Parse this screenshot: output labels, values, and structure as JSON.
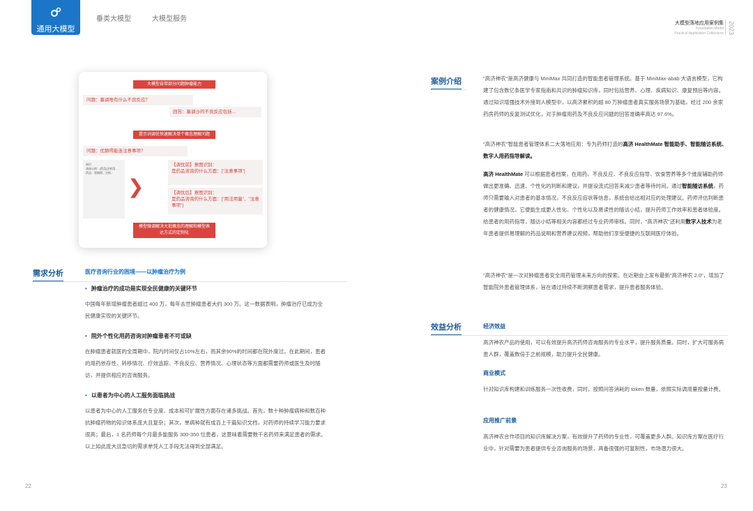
{
  "header": {
    "active_tab": "通用大模型",
    "tabs": [
      "垂类大模型",
      "大模型服务"
    ],
    "title_cn": "大模型落地应用案例集",
    "title_en_1": "Foundation Model",
    "title_en_2": "Practical Application Collections",
    "year": "2023"
  },
  "figure": {
    "red1": "大模型自带部分问题肿瘤能力",
    "q1": "问题：塞调唑有什么不良反应？",
    "a1": "回答：塞调沙的不良反应包括...",
    "red2": "提示词调优快速解决单个概念理解问题",
    "q2": "问题：优赫得能连注意事项？",
    "grey": "知识\n具体示例：[药品]注射用...\n药品：恩赫得、注射...",
    "before": "【调优前】意图识别：\n是药品咨询的什么方面：[\"注意事项\"]",
    "after": "【调优后】意图识别：\n是药品咨询的什么方面：[\"用法用量\"，\"注意事项\"]",
    "red3": "模型微调解决大批概念的理解和模型表\n达方式的定制化"
  },
  "left": {
    "section": "需求分析",
    "subtitle": "医疗咨询行业的困境——以肿瘤治疗为例",
    "b1": "肿瘤治疗的成功是实现全民健康的关键环节",
    "p1": "中国每年新增肿瘤患者超过 400 万，每年去世肿瘤患者大约 300 万。这一数据表明，肿瘤治疗已成为全民健康实现的关键环节。",
    "b2": "院外个性化用药咨询对肿瘤患者不可或缺",
    "p2": "在肿瘤患者就医的全周期中，院内时间仅占10%左右，而其余90%的时间都在院外度过。在此期间，患者的用药依存性、转移情况、疗效追踪、不良反应、营养情况、心理状态等方面都需要药师或医生及时随访，并提供相应的咨询服务。",
    "b3": "以患者为中心的人工服务面临挑战",
    "p3": "以患者为中心的人工服务在专业度、成本和可扩展性方面存在诸多挑战。首先，数十种肿瘤病种和数百种抗肿瘤药物的知识体系庞大且复杂；其次，单病种就有成百上千篇知识文档，对药师的持续学习能力要求很高；最后，1 名药师每个月最多能服务 300-350 位患者，这意味着需要数千名药师来满足患者的需求。以上如此庞大且急切的需求单凭人工手段无法得到全部满足。",
    "page": "22"
  },
  "right": {
    "section1": "案例介绍",
    "p1": "\"高济神农\"是高济健康与 MiniMax 共同打造的智能患者管理系统。基于 MiniMax-abab 大语言模型，它构建了包含数亿条医学专家指南和共识的肿瘤知识库，同时包括营养、心理、疾病知识、康复预后等内容。通过知识增强技术外接到人模型中，以高济累积的超 80 万肿瘤患者真实服务场景为基础，经过 200 余家药房药师的反复测试优化，对于肿瘤用药及不良反应问题的回答准确率高达 97.6%。",
    "p2a": "\"高济神农\"智能患者管理体系二大落地应用：专为药师打造的",
    "p2b": "高济 HealthMate 智能助手、智能随访系统、数字人用药指导解读。",
    "p3a": "高济 HealthMate",
    "p3b": " 可以根据患者档案，在用药、不良反应、不良反应指导、饮食营养等多个维度辅助药师做出更准确、迅速、个性化的判断和建议，并提设流式回答来减少患者等待时间。通过",
    "p3c": "智能随访系统",
    "p3d": "，药师只需要输入对患者的基本情况，不良反应症状等信息，系统会给出相对应的处理建议。药师评估判断患者的健康情况，它便能生成更人性化、个性化以及易读性的随访小结，提升药师工作效率和患者体验度。给患者的用药指导，随访小结等相关内容都经过专业药师审核。同时，\"高济神农\"还利用",
    "p3e": "数字人技术",
    "p3f": "为老年患者提供易理解的药品说明和营养建议视频，帮助他们享受便捷的互联网医疗体验。",
    "p4": "\"高济神农\"是一次对肿瘤患者安全用药管理未来方向的探索。在近期会上发布最新\"高济神农 2.0\"，增加了智能院外患者管理体系，旨在通过持续不断洞察患者需求，提升患者服务体验。",
    "section2": "效益分析",
    "s1": "经济效益",
    "s1p": "高济神农产品的使用，可以有效提升高济药师咨询服务的专业水平，提升服务质量。同时，扩大可服务病患人群，覆盖数倍于之前规模，助力提升全民健康。",
    "s2": "商业模式",
    "s2p": "针对知识库构建和训练服务一次性收费，同时，按照问答消耗的 token 数量，依照实际调用量按量计费。",
    "s3": "应用推广前景",
    "s3p": "高济神农合作项目的知识库解决方案，有效提升了药师的专业性，可覆盖更多人群。知识库方案在医疗行业中，针对需要为患者提供专业咨询服务的场景，具备很强的可复制性，市场潜力很大。",
    "page": "23"
  }
}
